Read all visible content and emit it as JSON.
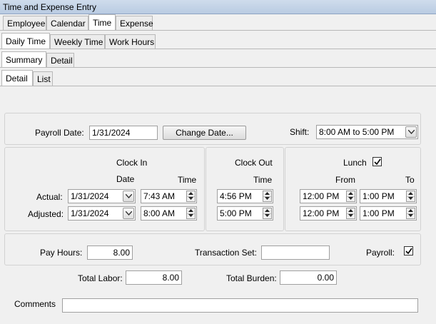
{
  "window": {
    "title": "Time and Expense Entry"
  },
  "tabs_level1": [
    "Employee",
    "Calendar",
    "Time",
    "Expense"
  ],
  "tabs_level2": [
    "Daily Time",
    "Weekly Time",
    "Work Hours"
  ],
  "tabs_level3": [
    "Summary",
    "Detail"
  ],
  "tabs_level4": [
    "Detail",
    "List"
  ],
  "header": {
    "payroll_date_label": "Payroll Date:",
    "payroll_date": "1/31/2024",
    "change_date_button": "Change Date...",
    "shift_label": "Shift:",
    "shift": "8:00 AM to 5:00 PM"
  },
  "clock_in": {
    "title": "Clock In",
    "date_header": "Date",
    "time_header": "Time",
    "actual_label": "Actual:",
    "adjusted_label": "Adjusted:",
    "actual_date": "1/31/2024",
    "actual_time": "7:43 AM",
    "adjusted_date": "1/31/2024",
    "adjusted_time": "8:00 AM"
  },
  "clock_out": {
    "title": "Clock Out",
    "time_header": "Time",
    "actual_time": "4:56 PM",
    "adjusted_time": "5:00 PM"
  },
  "lunch": {
    "title": "Lunch",
    "checked": true,
    "from_header": "From",
    "to_header": "To",
    "actual_from": "12:00 PM",
    "actual_to": "1:00 PM",
    "adjusted_from": "12:00 PM",
    "adjusted_to": "1:00 PM"
  },
  "summary": {
    "pay_hours_label": "Pay Hours:",
    "pay_hours": "8.00",
    "transaction_set_label": "Transaction Set:",
    "transaction_set": "",
    "payroll_label": "Payroll:",
    "payroll_checked": true,
    "total_labor_label": "Total Labor:",
    "total_labor": "8.00",
    "total_burden_label": "Total Burden:",
    "total_burden": "0.00",
    "comments_label": "Comments",
    "comments": ""
  }
}
